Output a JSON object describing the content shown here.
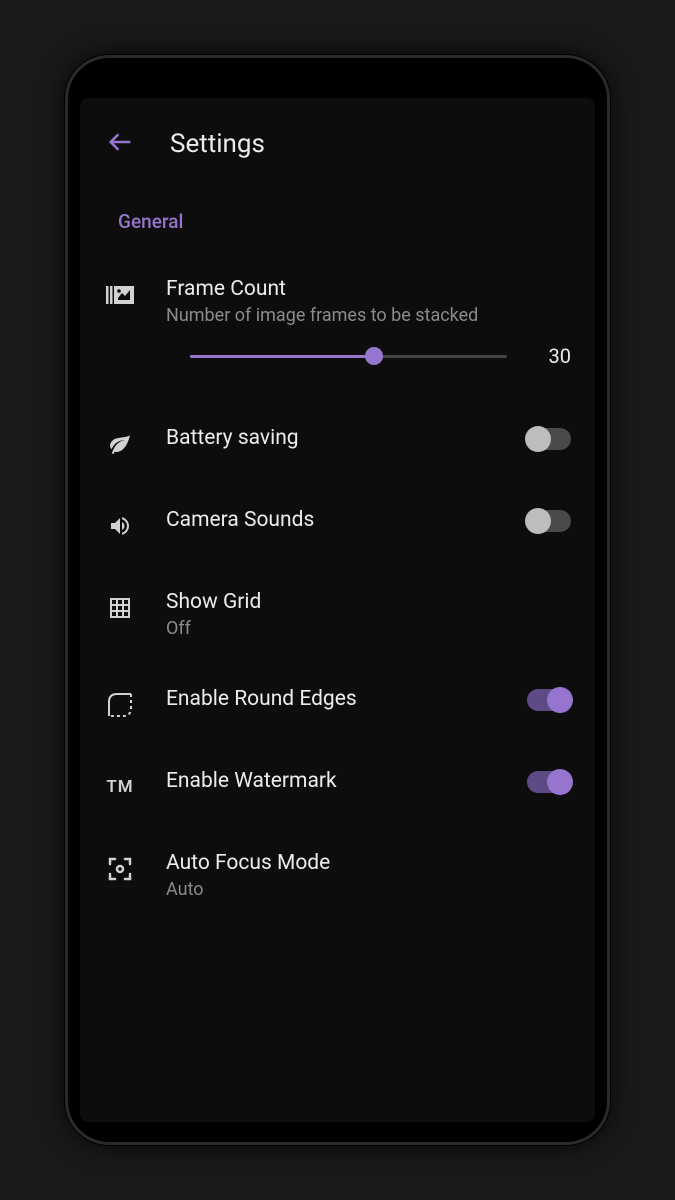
{
  "header": {
    "title": "Settings"
  },
  "section": {
    "general": "General"
  },
  "settings": {
    "frameCount": {
      "title": "Frame Count",
      "subtitle": "Number of image frames to be stacked",
      "value": "30",
      "sliderPercent": 58
    },
    "batterySaving": {
      "title": "Battery saving",
      "enabled": false
    },
    "cameraSounds": {
      "title": "Camera Sounds",
      "enabled": false
    },
    "showGrid": {
      "title": "Show Grid",
      "value": "Off"
    },
    "roundEdges": {
      "title": "Enable Round Edges",
      "enabled": true
    },
    "watermark": {
      "title": "Enable Watermark",
      "enabled": true
    },
    "autoFocus": {
      "title": "Auto Focus Mode",
      "value": "Auto"
    }
  }
}
